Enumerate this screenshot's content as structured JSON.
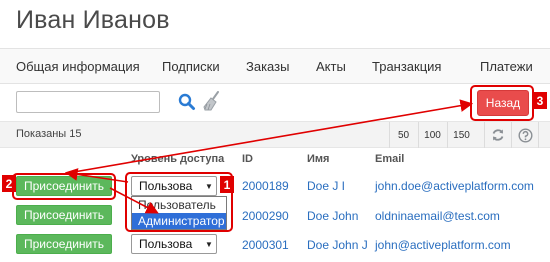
{
  "page": {
    "title": "Иван Иванов"
  },
  "tabs": [
    {
      "label": "Общая информация"
    },
    {
      "label": "Подписки"
    },
    {
      "label": "Заказы"
    },
    {
      "label": "Акты"
    },
    {
      "label": "Транзакция"
    },
    {
      "label": "Платежи"
    }
  ],
  "toolbar": {
    "search_value": "",
    "back_label": "Назад"
  },
  "pager": {
    "shown_text": "Показаны 15",
    "sizes": [
      "50",
      "100",
      "150"
    ]
  },
  "table": {
    "columns": [
      "Уровень доступа",
      "ID",
      "Имя",
      "Email"
    ],
    "join_label": "Присоединить",
    "rows": [
      {
        "role": "Пользова",
        "id": "2000189",
        "name": "Doe J I",
        "email": "john.doe@activeplatform.com"
      },
      {
        "role": "Пользова",
        "id": "2000290",
        "name": "Doe John",
        "email": "oldninaemail@test.com"
      },
      {
        "role": "Пользова",
        "id": "2000301",
        "name": "Doe John J",
        "email": "john@activeplatform.com"
      }
    ],
    "dropdown_options": [
      "Пользователь",
      "Администратор"
    ]
  },
  "annotations": {
    "badges": [
      "1",
      "2",
      "3"
    ],
    "color": "#e00000"
  }
}
